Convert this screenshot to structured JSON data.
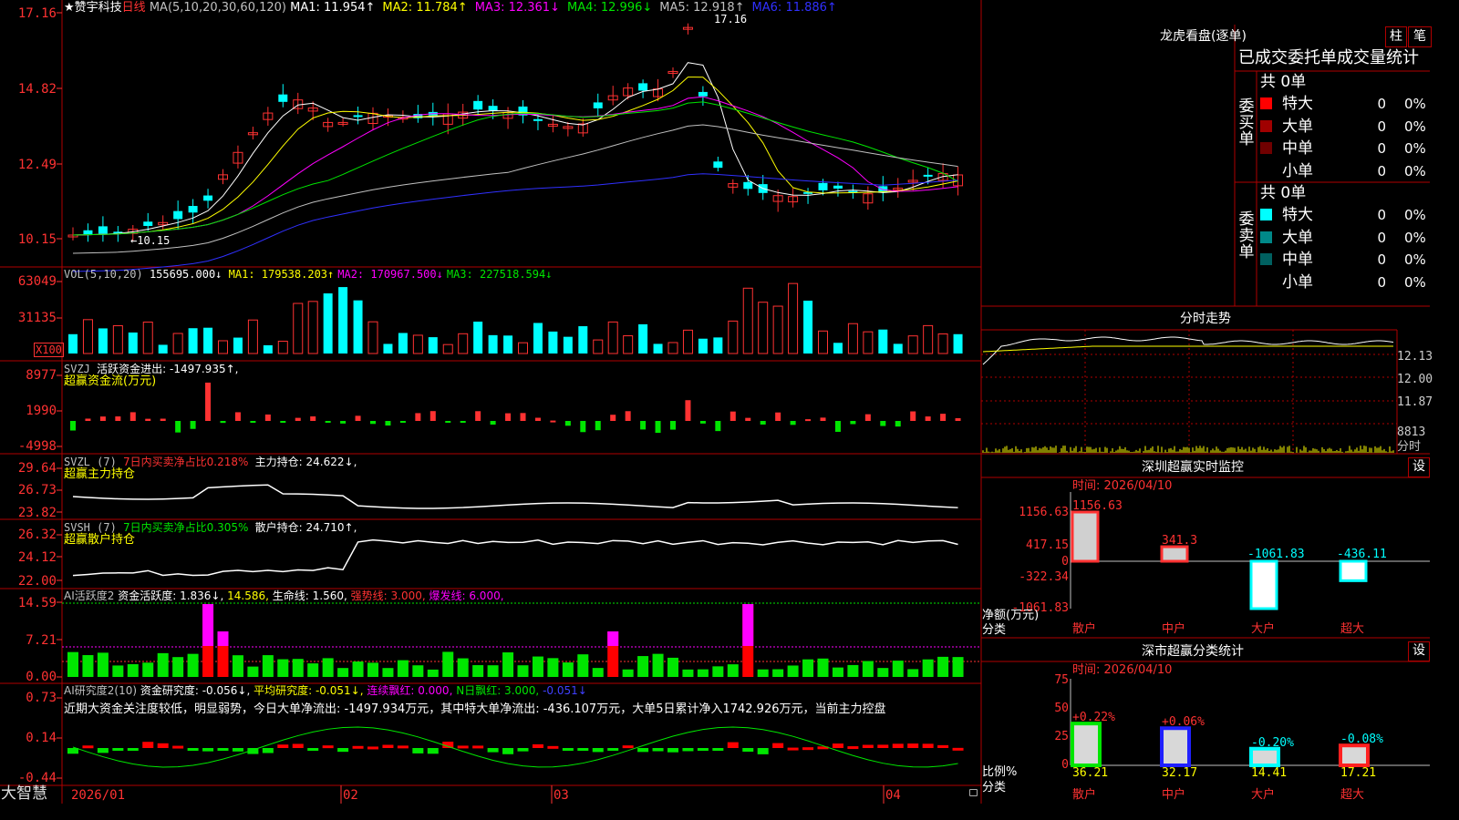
{
  "header": {
    "star": "★",
    "stock_name": "赞宇科技",
    "period": "日线",
    "ma_def": "MA(5,10,20,30,60,120)",
    "ma": [
      {
        "label": "MA1: 11.954↑",
        "color": "#ffffff"
      },
      {
        "label": "MA2: 11.784↑",
        "color": "#ffff00"
      },
      {
        "label": "MA3: 12.361↓",
        "color": "#ff00ff"
      },
      {
        "label": "MA4: 12.996↓",
        "color": "#00e600"
      },
      {
        "label": "MA5: 12.918↑",
        "color": "#c0c0c0"
      },
      {
        "label": "MA6: 11.886↑",
        "color": "#3030ff"
      }
    ]
  },
  "price_pane": {
    "ticks": [
      "17.16",
      "14.82",
      "12.49",
      "10.15"
    ],
    "high_label": "17.16",
    "low_label": "←10.15"
  },
  "vol_pane": {
    "ticks": [
      "63049",
      "31135"
    ],
    "unit": "X100",
    "title": "VOL(5,10,20)",
    "value": "155695.000↓",
    "ma": [
      {
        "label": "MA1: 179538.203↑",
        "color": "#ffff00"
      },
      {
        "label": "MA2: 170967.500↓",
        "color": "#ff00ff"
      },
      {
        "label": "MA3: 227518.594↓",
        "color": "#00e600"
      }
    ]
  },
  "svzj_pane": {
    "ticks": [
      "8977",
      "1990",
      "-4998"
    ],
    "title": "SVZJ",
    "text": "活跃资金进出: -1497.935↑,",
    "subtitle": "超赢资金流(万元)"
  },
  "svzl_pane": {
    "ticks": [
      "29.64",
      "26.73",
      "23.82"
    ],
    "title": "SVZL (7)",
    "text1": "7日内买卖净占比0.218%",
    "text2": "主力持仓: 24.622↓,",
    "subtitle": "超赢主力持仓"
  },
  "svsh_pane": {
    "ticks": [
      "26.32",
      "24.12",
      "22.00"
    ],
    "title": "SVSH (7)",
    "text1": "7日内买卖净占比0.305%",
    "text2": "散户持仓: 24.710↑,",
    "subtitle": "超赢散户持仓"
  },
  "ai_active_pane": {
    "ticks": [
      "14.59",
      "7.21",
      "0.00"
    ],
    "title": "AI活跃度2",
    "text1": "资金活跃度: 1.836↓,",
    "text2": "14.586,",
    "text3": "生命线: 1.560,",
    "text4": "强势线: 3.000,",
    "text5": "爆发线: 6.000,"
  },
  "ai_research_pane": {
    "ticks": [
      "0.73",
      "0.14",
      "-0.44"
    ],
    "title": "AI研究度2(10)",
    "text1": "资金研究度: -0.056↓,",
    "text2": "平均研究度: -0.051↓,",
    "text3": "连续飘红: 0.000,",
    "text4": "N日飘红: 3.000,",
    "text5": "-0.051↓",
    "comment": "近期大资金关注度较低，明显弱势，今日大单净流出: -1497.934万元，其中特大单净流出: -436.107万元，大单5日累计净入1742.926万元，当前主力控盘"
  },
  "xaxis": {
    "logo": "大智慧",
    "labels": [
      "2026/01",
      "02",
      "03",
      "04"
    ]
  },
  "longhu": {
    "title": "龙虎看盘(逐单)",
    "btn1": "柱",
    "btn2": "笔",
    "tab": "已成交委托单成交量统计",
    "buy_label": "委买单",
    "sell_label": "委卖单",
    "buy_total": "共 0单",
    "sell_total": "共 0单",
    "buy_rows": [
      {
        "name": "特大",
        "color": "#ff0000",
        "count": "0",
        "pct": "0%"
      },
      {
        "name": "大单",
        "color": "#a00000",
        "count": "0",
        "pct": "0%"
      },
      {
        "name": "中单",
        "color": "#700000",
        "count": "0",
        "pct": "0%"
      },
      {
        "name": "小单",
        "color": "#000000",
        "count": "0",
        "pct": "0%"
      }
    ],
    "sell_rows": [
      {
        "name": "特大",
        "color": "#00ffff",
        "count": "0",
        "pct": "0%"
      },
      {
        "name": "大单",
        "color": "#008888",
        "count": "0",
        "pct": "0%"
      },
      {
        "name": "中单",
        "color": "#006060",
        "count": "0",
        "pct": "0%"
      },
      {
        "name": "小单",
        "color": "#000000",
        "count": "0",
        "pct": "0%"
      }
    ]
  },
  "intraday": {
    "title": "分时走势",
    "labels": [
      "12.13",
      "12.00",
      "11.87",
      "8813"
    ],
    "label_colors": [
      "#ff3232",
      "#c0c0c0",
      "#00ffff",
      "#c0c0c0"
    ],
    "bottom": "分时"
  },
  "sz_monitor": {
    "title": "深圳超赢实时监控",
    "btn": "设",
    "time": "时间: 2026/04/10",
    "ticks": [
      "1156.63",
      "417.15",
      "0",
      "-322.34",
      "-1061.83"
    ],
    "ylabel1": "净额(万元)",
    "ylabel2": "分类",
    "categories": [
      "散户",
      "中户",
      "大户",
      "超大"
    ],
    "bars": [
      {
        "value": 1156.63,
        "label": "1156.63",
        "color": "#ff3232"
      },
      {
        "value": 341.3,
        "label": "341.3",
        "color": "#ff3232"
      },
      {
        "value": -1061.83,
        "label": "-1061.83",
        "color": "#00ffff"
      },
      {
        "value": -436.11,
        "label": "-436.11",
        "color": "#00ffff"
      }
    ]
  },
  "sz_class": {
    "title": "深市超赢分类统计",
    "btn": "设",
    "time": "时间: 2026/04/10",
    "ticks": [
      "75",
      "50",
      "25",
      "0"
    ],
    "ylabel1": "比例%",
    "ylabel2": "分类",
    "categories": [
      "散户",
      "中户",
      "大户",
      "超大"
    ],
    "bars": [
      {
        "value": 36.21,
        "label": "36.21",
        "change": "+0.22%",
        "change_color": "#ff3232",
        "fill": "#00e600"
      },
      {
        "value": 32.17,
        "label": "32.17",
        "change": "+0.06%",
        "change_color": "#ff3232",
        "fill": "#2020ff"
      },
      {
        "value": 14.41,
        "label": "14.41",
        "change": "-0.20%",
        "change_color": "#00ffff",
        "fill": "#00ffff"
      },
      {
        "value": 17.21,
        "label": "17.21",
        "change": "-0.08%",
        "change_color": "#00ffff",
        "fill": "#ff2020"
      }
    ]
  }
}
